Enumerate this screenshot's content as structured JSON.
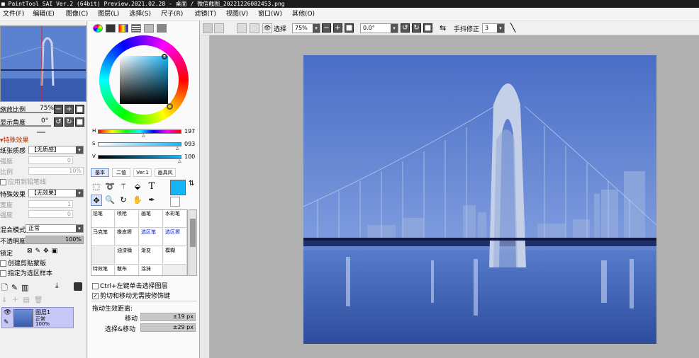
{
  "titlebar": {
    "text": "■ PaintTool SAI Ver.2 (64bit) Preview.2021.02.28 - 桌面 / 微信截图_20221226082453.png"
  },
  "menu": [
    "文件(F)",
    "编辑(E)",
    "图像(C)",
    "图层(L)",
    "选择(S)",
    "尺子(R)",
    "滤镜(T)",
    "视图(V)",
    "窗口(W)",
    "其他(O)"
  ],
  "toolbar": {
    "select_label": "选择",
    "zoom": "75%",
    "angle": "0.0°",
    "stabilizer_label": "手抖修正",
    "stabilizer_value": "3"
  },
  "navigator": {
    "zoom_label": "缩放比例",
    "zoom_value": "75%",
    "angle_label": "显示角度",
    "angle_value": "0°"
  },
  "effects": {
    "section_title": "特殊效果",
    "paper_label": "纸张质感",
    "paper_value": "【无质感】",
    "strength_label": "强度",
    "strength_value": "0",
    "scale_label": "比例",
    "scale_value": "10%",
    "apply_pen_label": "应用到铅笔线",
    "effect_label": "特殊效果",
    "effect_value": "【无效果】",
    "width_label": "宽度",
    "width_value": "1",
    "strength2_label": "强度",
    "strength2_value": "0"
  },
  "layer_props": {
    "blend_label": "混合模式",
    "blend_value": "正常",
    "opacity_label": "不透明度",
    "opacity_value": "100%",
    "lock_label": "锁定",
    "clip_label": "创建剪贴蒙版",
    "selection_source_label": "指定为选区样本"
  },
  "layer": {
    "name": "图层1",
    "mode": "正常",
    "opacity": "100%"
  },
  "color": {
    "h_label": "H",
    "h_value": "197",
    "s_label": "S",
    "s_value": "093",
    "v_label": "V",
    "v_value": "100",
    "foreground": "#18b4f8"
  },
  "tool_tabs": [
    "基本",
    "二值",
    "Ver.1",
    "画具风"
  ],
  "brushes": [
    "铅笔",
    "喷枪",
    "画笔",
    "水彩笔",
    "马克笔",
    "橡皮擦",
    "选区笔",
    "选区擦",
    "",
    "油漆桶",
    "渐变",
    "模糊",
    "特效笔",
    "散布",
    "涂抹",
    ""
  ],
  "options": {
    "ctrl_label": "Ctrl+左键单击选择图层",
    "cut_label": "剪切和移动无需按修饰键",
    "drag_title": "拖动生效距离:",
    "move_label": "移动",
    "move_value": "±19 px",
    "selmove_label": "选择&移动",
    "selmove_value": "±29 px"
  }
}
